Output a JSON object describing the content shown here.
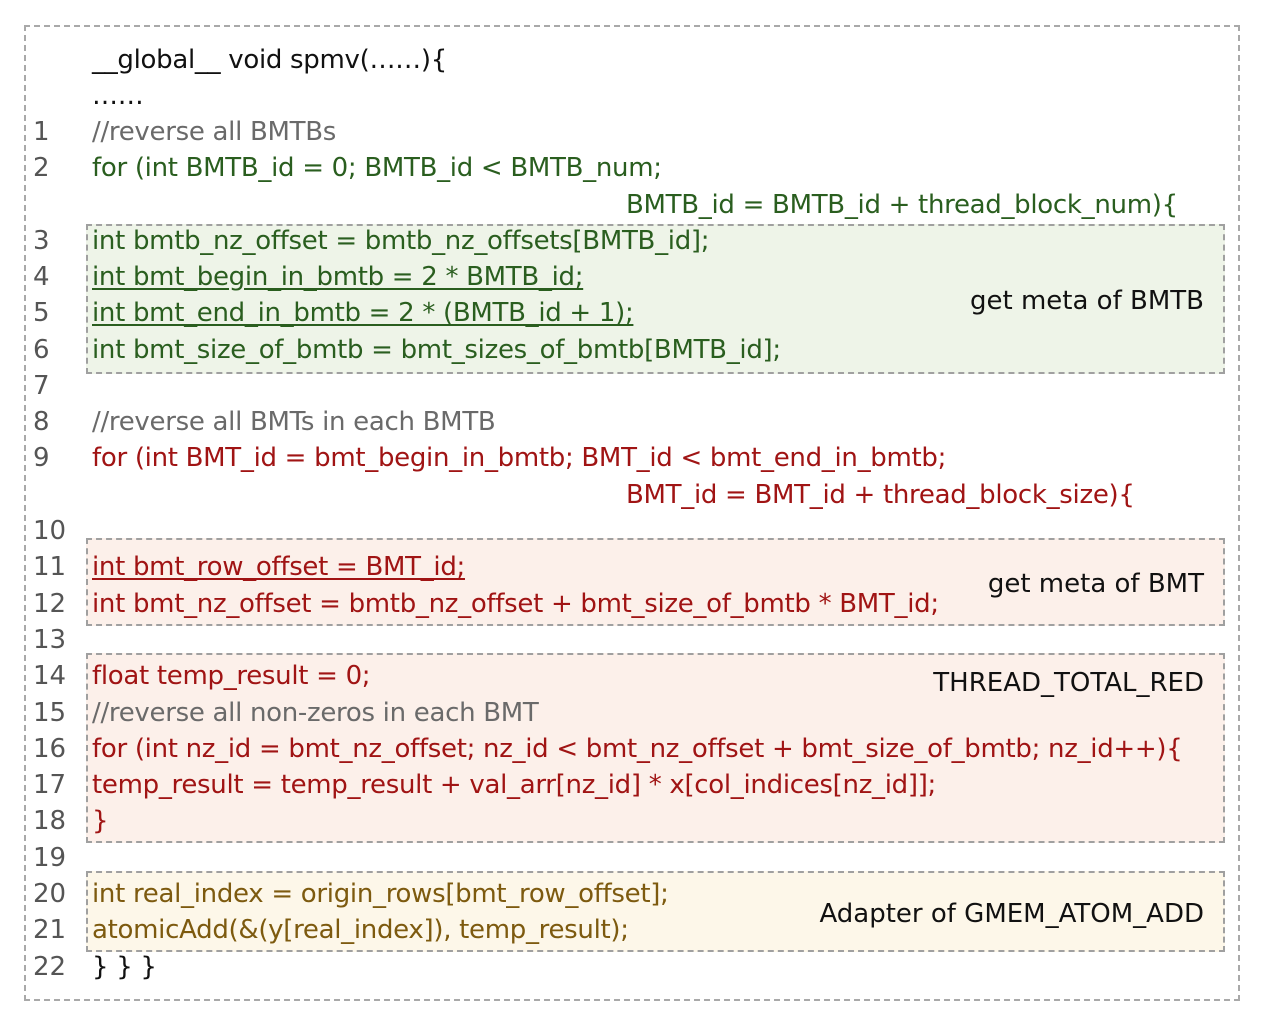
{
  "header": {
    "signature": "__global__ void spmv(……){",
    "ellipsis": "……"
  },
  "line_numbers": [
    "1",
    "2",
    "3",
    "4",
    "5",
    "6",
    "7",
    "8",
    "9",
    "10",
    "11",
    "12",
    "13",
    "14",
    "15",
    "16",
    "17",
    "18",
    "19",
    "20",
    "21",
    "22"
  ],
  "code": {
    "l1": "//reverse all BMTBs",
    "l2a": "for (int BMTB_id = 0; BMTB_id < BMTB_num;",
    "l2b": "BMTB_id = BMTB_id + thread_block_num){",
    "l3": "int bmtb_nz_offset = bmtb_nz_offsets[BMTB_id];",
    "l4": "int bmt_begin_in_bmtb = 2 * BMTB_id;",
    "l5": "int bmt_end_in_bmtb = 2 * (BMTB_id + 1);",
    "l6": "int bmt_size_of_bmtb = bmt_sizes_of_bmtb[BMTB_id];",
    "l8": "//reverse all BMTs in each BMTB",
    "l9a": "for (int BMT_id = bmt_begin_in_bmtb; BMT_id < bmt_end_in_bmtb;",
    "l9b": "BMT_id = BMT_id + thread_block_size){",
    "l11": "int bmt_row_offset = BMT_id;",
    "l12": "int bmt_nz_offset = bmtb_nz_offset + bmt_size_of_bmtb * BMT_id;",
    "l14": "float temp_result = 0;",
    "l15": "//reverse all non-zeros in each BMT",
    "l16": "for (int nz_id = bmt_nz_offset; nz_id < bmt_nz_offset + bmt_size_of_bmtb; nz_id++){",
    "l17": "temp_result = temp_result + val_arr[nz_id] * x[col_indices[nz_id]];",
    "l18": "}",
    "l20": "int real_index = origin_rows[bmt_row_offset];",
    "l21": "atomicAdd(&(y[real_index]), temp_result);",
    "l22": "} } }"
  },
  "labels": {
    "green": "get meta of BMTB",
    "red1": "get meta of BMT",
    "red2": "THREAD_TOTAL_RED",
    "yellow": "Adapter of GMEM_ATOM_ADD"
  },
  "colors": {
    "green_text": "#2a5e1f",
    "red_text": "#a01414",
    "olive_text": "#7d5a0f",
    "comment_text": "#6a6a6a",
    "green_box": "#eef4e8",
    "red_box": "#fcf0ea",
    "yellow_box": "#fdf7e9",
    "dashed_border": "#a9a9a9"
  }
}
